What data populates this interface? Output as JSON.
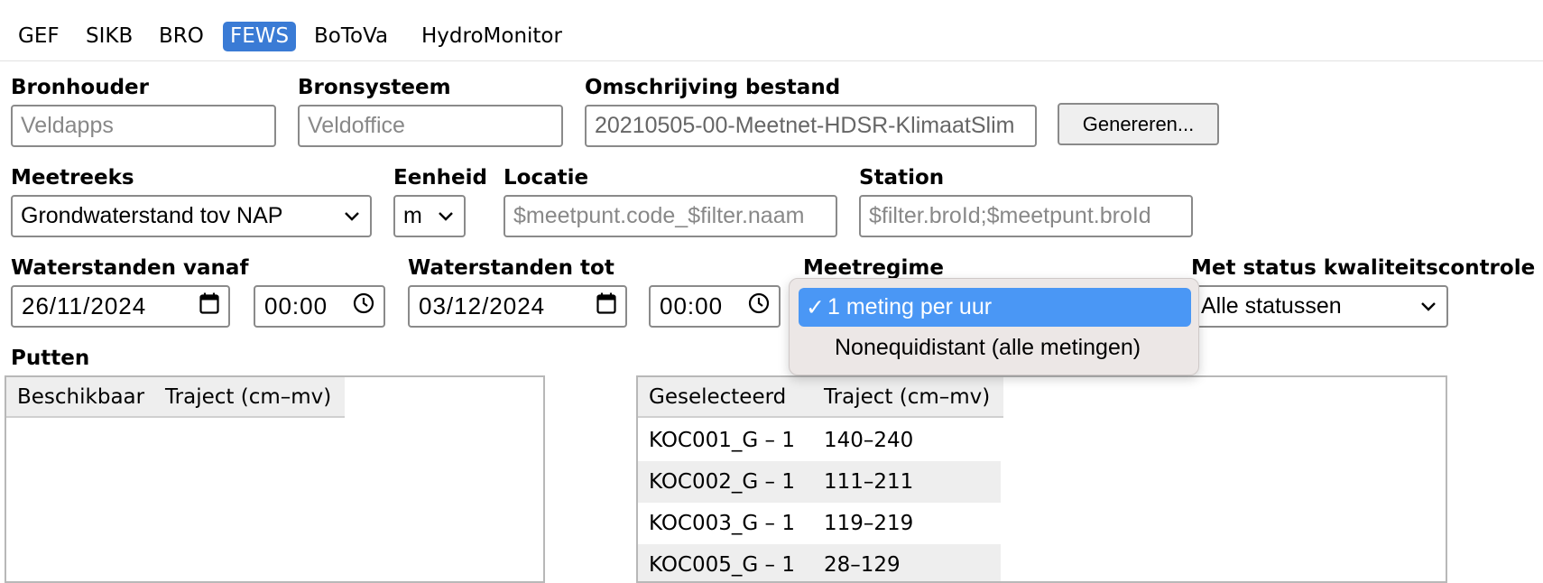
{
  "tabs": [
    {
      "label": "GEF"
    },
    {
      "label": "SIKB"
    },
    {
      "label": "BRO"
    },
    {
      "label": "FEWS",
      "active": true
    },
    {
      "label": "BoToVa"
    },
    {
      "label": "HydroMonitor"
    }
  ],
  "form": {
    "bronhouder": {
      "label": "Bronhouder",
      "placeholder": "Veldapps"
    },
    "bronsysteem": {
      "label": "Bronsysteem",
      "placeholder": "Veldoffice"
    },
    "omschrijving": {
      "label": "Omschrijving bestand",
      "value": "20210505-00-Meetnet-HDSR-KlimaatSlim"
    },
    "genereren_button": "Genereren...",
    "meetreeks": {
      "label": "Meetreeks",
      "value": "Grondwaterstand tov NAP"
    },
    "eenheid": {
      "label": "Eenheid",
      "value": "m"
    },
    "locatie": {
      "label": "Locatie",
      "placeholder": "$meetpunt.code_$filter.naam"
    },
    "station": {
      "label": "Station",
      "placeholder": "$filter.broId;$meetpunt.broId"
    },
    "waterstanden_vanaf": {
      "label": "Waterstanden vanaf",
      "date": "26/11/2024",
      "time": "00:00"
    },
    "waterstanden_tot": {
      "label": "Waterstanden tot",
      "date": "03/12/2024",
      "time": "00:00"
    },
    "meetregime": {
      "label": "Meetregime",
      "options": [
        {
          "label": "1 meting per uur",
          "selected": true,
          "check": "✓"
        },
        {
          "label": "Nonequidistant (alle metingen)",
          "selected": false
        }
      ]
    },
    "status": {
      "label": "Met status kwaliteitscontrole",
      "value": "Alle statussen"
    }
  },
  "putten": {
    "label": "Putten",
    "beschikbaar": {
      "headers": [
        "Beschikbaar",
        "Traject (cm–mv)"
      ],
      "rows": []
    },
    "geselecteerd": {
      "headers": [
        "Geselecteerd",
        "Traject (cm–mv)"
      ],
      "rows": [
        {
          "name": "KOC001_G – 1",
          "traject": "140–240"
        },
        {
          "name": "KOC002_G – 1",
          "traject": "111–211"
        },
        {
          "name": "KOC003_G – 1",
          "traject": "119–219"
        },
        {
          "name": "KOC005_G – 1",
          "traject": "28–129"
        }
      ]
    }
  },
  "colors": {
    "active_tab": "#3a7bd5",
    "selected_option": "#4a97f5",
    "popup_bg": "#ece7e6"
  },
  "icons": {
    "calendar": "calendar-icon",
    "clock": "clock-icon",
    "chevron": "chevron-down-icon",
    "check": "checkmark-icon"
  }
}
